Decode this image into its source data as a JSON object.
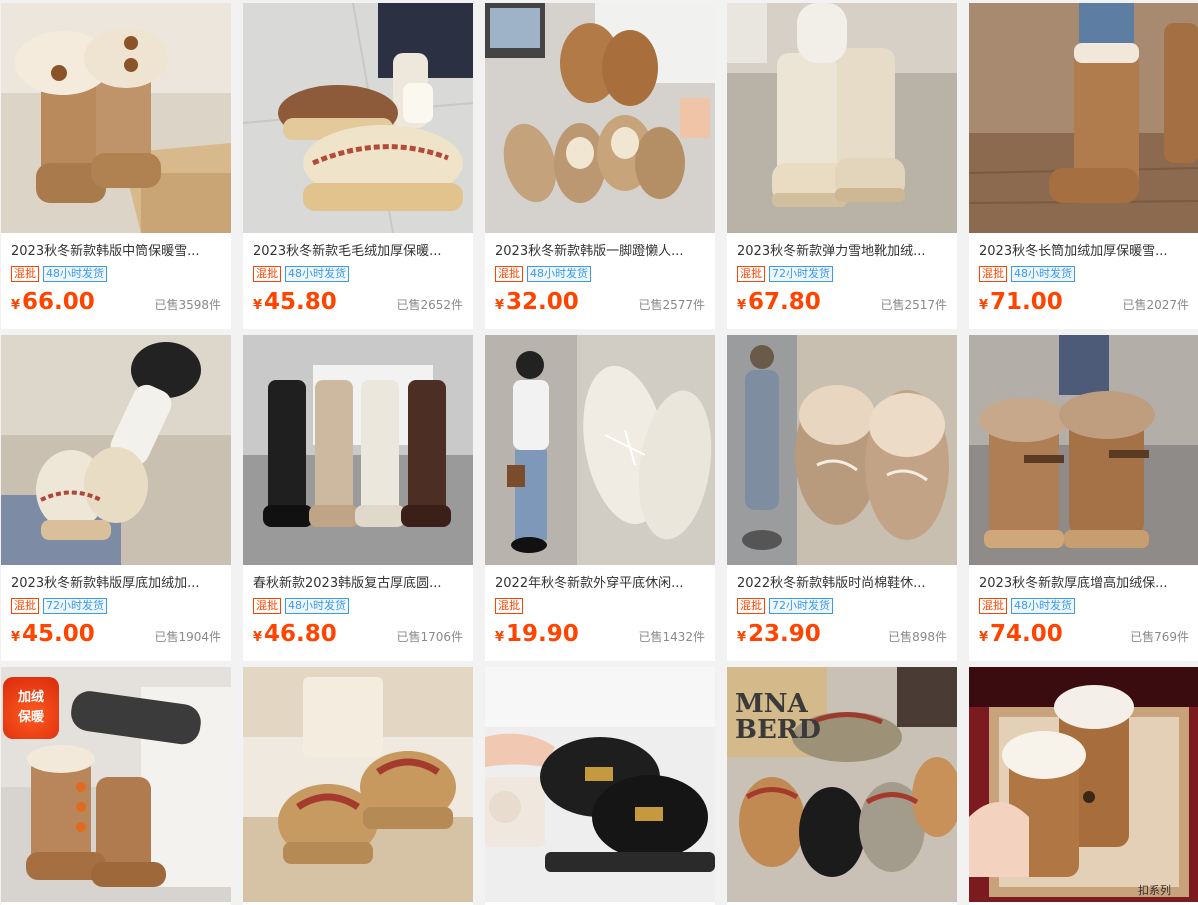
{
  "products": [
    {
      "title": "2023秋冬新款韩版中筒保暖雪...",
      "tags": [
        "混批",
        "48小时发货"
      ],
      "currency": "¥",
      "price": "66.00",
      "sold": "已售3598件"
    },
    {
      "title": "2023秋冬新款毛毛绒加厚保暖...",
      "tags": [
        "混批",
        "48小时发货"
      ],
      "currency": "¥",
      "price": "45.80",
      "sold": "已售2652件"
    },
    {
      "title": "2023秋冬新款韩版一脚蹬懒人...",
      "tags": [
        "混批",
        "48小时发货"
      ],
      "currency": "¥",
      "price": "32.00",
      "sold": "已售2577件"
    },
    {
      "title": "2023秋冬新款弹力雪地靴加绒...",
      "tags": [
        "混批",
        "72小时发货"
      ],
      "currency": "¥",
      "price": "67.80",
      "sold": "已售2517件"
    },
    {
      "title": "2023秋冬长筒加绒加厚保暖雪...",
      "tags": [
        "混批",
        "48小时发货"
      ],
      "currency": "¥",
      "price": "71.00",
      "sold": "已售2027件"
    },
    {
      "title": "2023秋冬新款韩版厚底加绒加...",
      "tags": [
        "混批",
        "72小时发货"
      ],
      "currency": "¥",
      "price": "45.00",
      "sold": "已售1904件"
    },
    {
      "title": "春秋新款2023韩版复古厚底圆...",
      "tags": [
        "混批",
        "48小时发货"
      ],
      "currency": "¥",
      "price": "46.80",
      "sold": "已售1706件"
    },
    {
      "title": " 2022年秋冬新款外穿平底休闲...",
      "tags": [
        "混批"
      ],
      "currency": "¥",
      "price": "19.90",
      "sold": "已售1432件"
    },
    {
      "title": "2022秋冬新款韩版时尚棉鞋休...",
      "tags": [
        "混批",
        "72小时发货"
      ],
      "currency": "¥",
      "price": "23.90",
      "sold": "已售898件"
    },
    {
      "title": "2023秋冬新款厚底增高加绒保...",
      "tags": [
        "混批",
        "48小时发货"
      ],
      "currency": "¥",
      "price": "74.00",
      "sold": "已售769件"
    }
  ],
  "row3_images": [
    {
      "badge_line1": "加绒",
      "badge_line2": "保暖"
    },
    {},
    {},
    {
      "brand_text": "MNA",
      "brand_text2": "BERD"
    },
    {
      "box_text": "扣系列"
    }
  ]
}
